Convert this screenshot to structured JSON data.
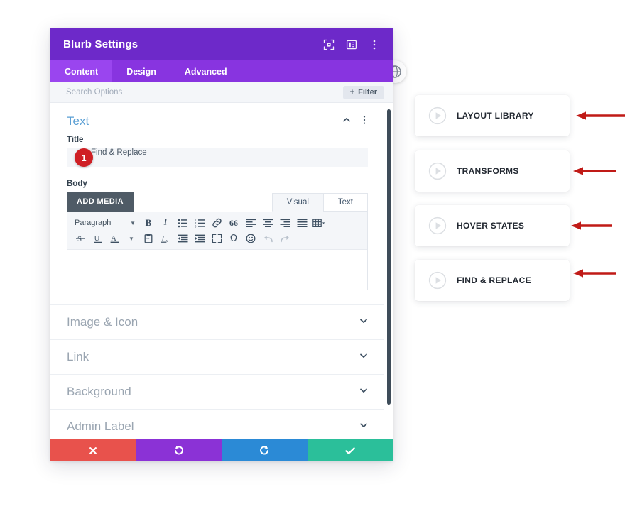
{
  "modal": {
    "title": "Blurb Settings",
    "header_icons": [
      {
        "name": "focus-target-icon"
      },
      {
        "name": "panel-layout-icon"
      },
      {
        "name": "kebab-menu-icon"
      }
    ],
    "tabs": [
      {
        "label": "Content",
        "active": true
      },
      {
        "label": "Design",
        "active": false
      },
      {
        "label": "Advanced",
        "active": false
      }
    ],
    "search": {
      "placeholder": "Search Options"
    },
    "filter_button": {
      "label": "Filter",
      "plus": "+"
    },
    "sections": {
      "open": {
        "title": "Text",
        "fields": {
          "title_label": "Title",
          "title_value": "Find & Replace",
          "badge": "1",
          "body_label": "Body",
          "add_media": "ADD MEDIA"
        },
        "editor_tabs": [
          {
            "label": "Visual",
            "active": true
          },
          {
            "label": "Text",
            "active": false
          }
        ],
        "format_select": "Paragraph",
        "toolbar_row1": [
          "bold-icon",
          "italic-icon",
          "bulleted-list-icon",
          "numbered-list-icon",
          "link-icon",
          "blockquote-icon",
          "align-left-icon",
          "align-center-icon",
          "align-right-icon",
          "align-justify-icon",
          "table-icon"
        ],
        "toolbar_row2": [
          "strikethrough-icon",
          "underline-icon",
          "text-color-icon",
          "paste-as-text-icon",
          "clear-formatting-icon",
          "outdent-icon",
          "indent-icon",
          "fullscreen-icon",
          "special-character-icon",
          "emoji-icon",
          "undo-icon",
          "redo-icon"
        ],
        "editor_content": ""
      },
      "closed": [
        {
          "title": "Image & Icon"
        },
        {
          "title": "Link"
        },
        {
          "title": "Background"
        },
        {
          "title": "Admin Label"
        }
      ]
    },
    "footer_buttons": [
      {
        "name": "cancel-button",
        "icon": "close-icon",
        "color": "#e8524c"
      },
      {
        "name": "undo-button",
        "icon": "undo-icon",
        "color": "#8b32d6"
      },
      {
        "name": "redo-button",
        "icon": "redo-icon",
        "color": "#2b8ad6"
      },
      {
        "name": "save-button",
        "icon": "check-icon",
        "color": "#2bbf9a"
      }
    ]
  },
  "cards": [
    {
      "label": "LAYOUT LIBRARY"
    },
    {
      "label": "TRANSFORMS"
    },
    {
      "label": "HOVER STATES"
    },
    {
      "label": "FIND & REPLACE"
    }
  ],
  "colors": {
    "header_purple": "#6d29c9",
    "tabbar_purple": "#8834e0",
    "tab_active_purple": "#9a45ef",
    "section_title_blue": "#5a9fd4",
    "badge_red": "#cf1f24",
    "arrow_red": "#c01a17"
  }
}
